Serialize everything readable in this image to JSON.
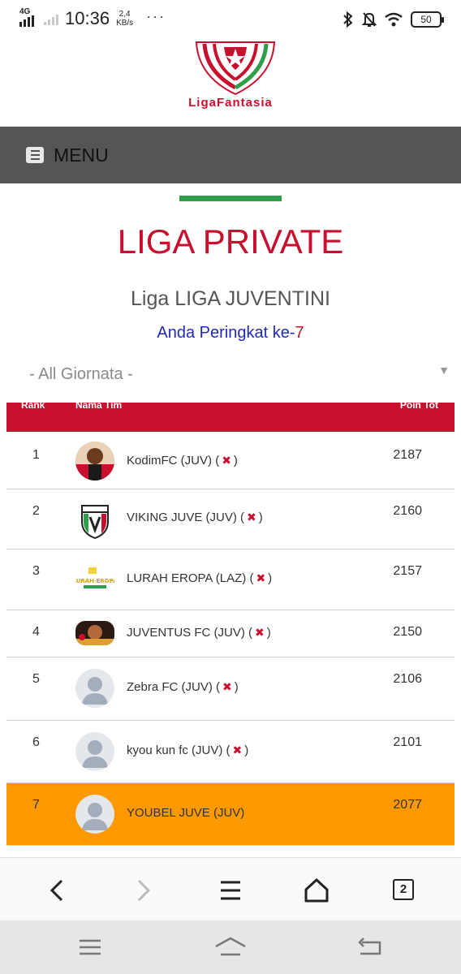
{
  "status_bar": {
    "network_label": "4G",
    "time": "10:36",
    "net_speed_value": "2,4",
    "net_speed_unit": "KB/s",
    "more": "···",
    "battery": "50"
  },
  "logo": {
    "text": "LigaFantasia"
  },
  "menu": {
    "label": "MENU",
    "icon": "menu-icon"
  },
  "page": {
    "title": "LIGA PRIVATE",
    "league_name": "Liga LIGA JUVENTINI",
    "rank_text": "Anda Peringkat ke-",
    "rank_number": "7"
  },
  "filter": {
    "selected": "- All Giornata -"
  },
  "table": {
    "header": {
      "rank": "Rank",
      "team": "Nama Tim",
      "points": "Poin Tot"
    },
    "rows": [
      {
        "rank": "1",
        "team": "KodimFC (JUV)",
        "points": "2187",
        "removable": true,
        "avatar": "photo-player"
      },
      {
        "rank": "2",
        "team": "VIKING JUVE (JUV)",
        "points": "2160",
        "removable": true,
        "avatar": "viking-shield"
      },
      {
        "rank": "3",
        "team": "LURAH EROPA (LAZ)",
        "points": "2157",
        "removable": true,
        "avatar": "lurah-eropa-logo"
      },
      {
        "rank": "4",
        "team": "JUVENTUS FC (JUV)",
        "points": "2150",
        "removable": true,
        "avatar": "photo-wide"
      },
      {
        "rank": "5",
        "team": "Zebra FC (JUV)",
        "points": "2106",
        "removable": true,
        "avatar": "default-user"
      },
      {
        "rank": "6",
        "team": "kyou kun fc (JUV)",
        "points": "2101",
        "removable": true,
        "avatar": "default-user"
      },
      {
        "rank": "7",
        "team": "YOUBEL JUVE (JUV)",
        "points": "2077",
        "removable": false,
        "avatar": "default-user",
        "highlight": true
      }
    ],
    "remove_symbol": "✖",
    "open_paren": "(",
    "close_paren": ")"
  },
  "colors": {
    "brand_red": "#c8102e",
    "brand_green": "#2e9e48",
    "menu_bg": "#555555",
    "highlight_row": "#ff9900",
    "rank_blue": "#1f2bb8"
  },
  "browser_nav": {
    "tab_count": "2",
    "icons": [
      "back-icon",
      "forward-icon",
      "menu-icon",
      "home-icon",
      "tabs-icon"
    ]
  },
  "system_nav": {
    "icons": [
      "recents-icon",
      "home-icon",
      "back-icon"
    ]
  }
}
